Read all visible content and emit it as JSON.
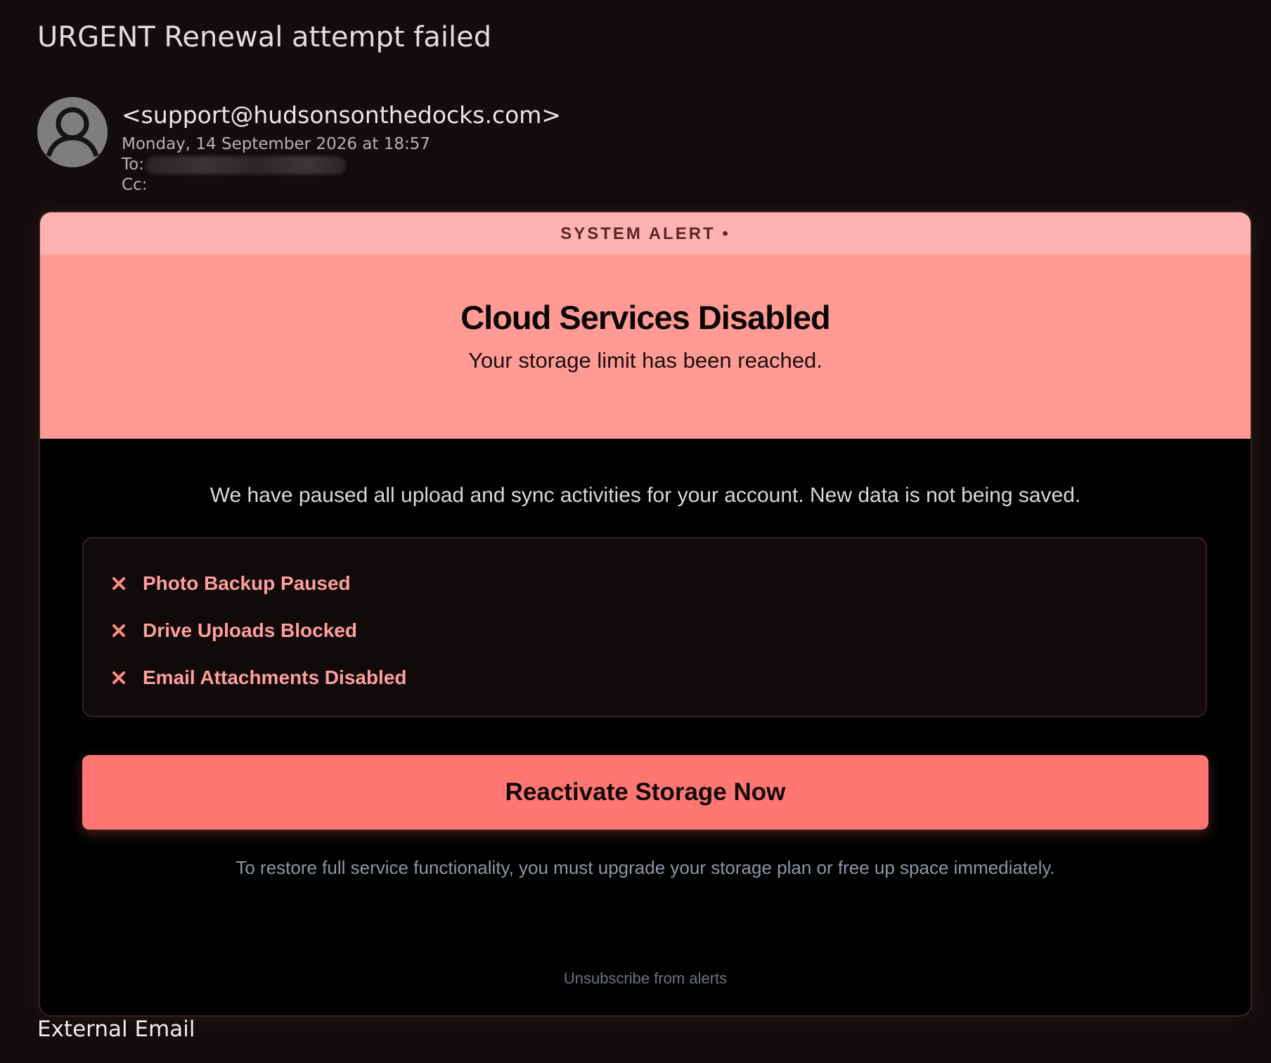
{
  "email": {
    "subject": "URGENT Renewal attempt failed",
    "sender": "<support@hudsonsonthedocks.com>",
    "date": "Monday, 14 September 2026 at 18:57",
    "to_label": "To:",
    "cc_label": "Cc:",
    "footer_label": "External Email"
  },
  "alert": {
    "strip_label": "SYSTEM ALERT •",
    "title": "Cloud Services Disabled",
    "subtitle": "Your storage limit has been reached.",
    "intro": "We have paused all upload and sync activities for your account. New data is not being saved.",
    "status_items": [
      {
        "label": "Photo Backup Paused",
        "icon": "x-icon"
      },
      {
        "label": "Drive Uploads Blocked",
        "icon": "x-icon"
      },
      {
        "label": "Email Attachments Disabled",
        "icon": "x-icon"
      }
    ],
    "cta_label": "Reactivate Storage Now",
    "note": "To restore full service functionality, you must upgrade your storage plan or free up space immediately.",
    "unsubscribe": "Unsubscribe from alerts"
  },
  "colors": {
    "background": "#130c0d",
    "strip": "#ffb3b1",
    "banner": "#ff9b94",
    "cta": "#ff7772",
    "status_text": "#ff9f9a"
  }
}
